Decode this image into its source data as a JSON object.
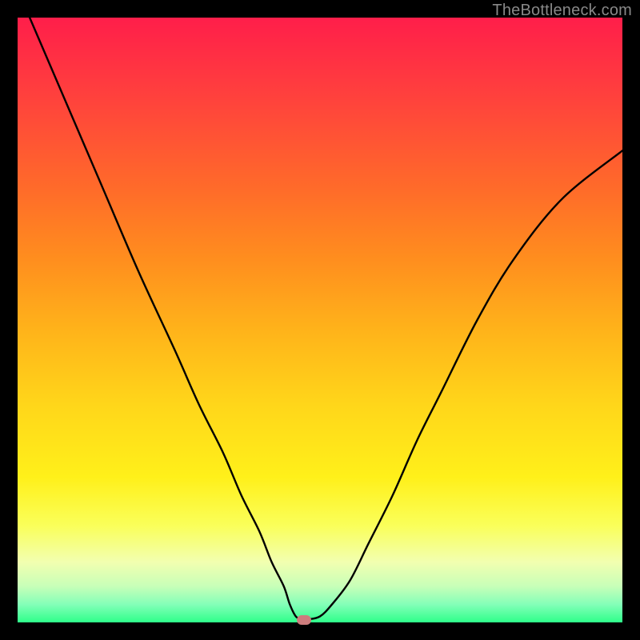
{
  "watermark": "TheBottleneck.com",
  "colors": {
    "frame_border": "#000000",
    "curve_stroke": "#000000",
    "marker_fill": "#cd7d7d",
    "gradient_top": "#ff1e4a",
    "gradient_bottom": "#2eff8a"
  },
  "chart_data": {
    "type": "line",
    "title": "",
    "xlabel": "",
    "ylabel": "",
    "xlim": [
      0,
      100
    ],
    "ylim": [
      0,
      100
    ],
    "grid": false,
    "series": [
      {
        "name": "bottleneck-curve",
        "x": [
          2,
          8,
          14,
          20,
          26,
          30,
          34,
          37,
          40,
          42,
          44,
          45,
          46,
          47,
          48,
          50,
          52,
          55,
          58,
          62,
          66,
          70,
          76,
          82,
          90,
          100
        ],
        "y": [
          100,
          86,
          72,
          58,
          45,
          36,
          28,
          21,
          15,
          10,
          6,
          3,
          1,
          0.5,
          0.5,
          1,
          3,
          7,
          13,
          21,
          30,
          38,
          50,
          60,
          70,
          78
        ]
      }
    ],
    "marker": {
      "x": 47.3,
      "y": 0.4
    },
    "background_gradient": {
      "direction": "top-to-bottom",
      "stops": [
        {
          "pos": 0,
          "color": "#ff1e4a"
        },
        {
          "pos": 12,
          "color": "#ff3e3e"
        },
        {
          "pos": 28,
          "color": "#ff6a2a"
        },
        {
          "pos": 40,
          "color": "#ff8e1e"
        },
        {
          "pos": 52,
          "color": "#ffb41a"
        },
        {
          "pos": 64,
          "color": "#ffd61a"
        },
        {
          "pos": 76,
          "color": "#fff01a"
        },
        {
          "pos": 84,
          "color": "#faff5a"
        },
        {
          "pos": 90,
          "color": "#f2ffb0"
        },
        {
          "pos": 94,
          "color": "#c8ffb8"
        },
        {
          "pos": 97,
          "color": "#84ffb8"
        },
        {
          "pos": 100,
          "color": "#2eff8a"
        }
      ]
    }
  }
}
